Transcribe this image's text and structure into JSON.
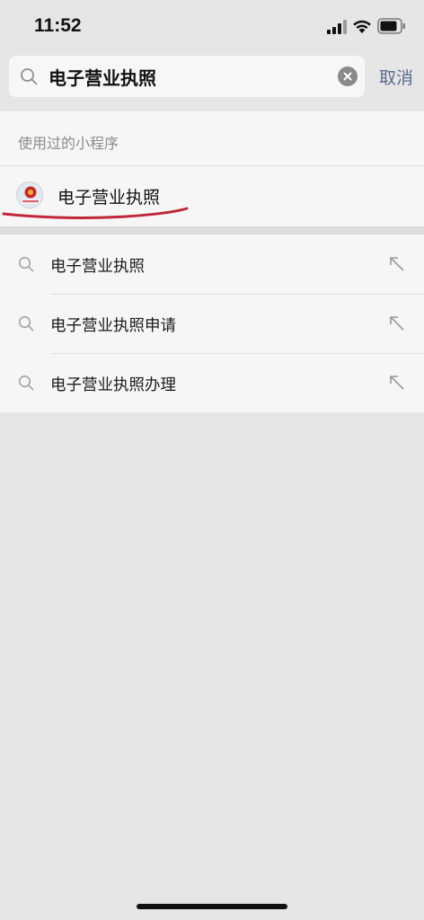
{
  "status_bar": {
    "time": "11:52"
  },
  "search": {
    "query": "电子营业执照",
    "cancel_label": "取消"
  },
  "mini_programs": {
    "section_title": "使用过的小程序",
    "items": [
      {
        "label": "电子营业执照",
        "avatar_text": "电子营业执照"
      }
    ]
  },
  "suggestions": [
    {
      "label": "电子营业执照"
    },
    {
      "label": "电子营业执照申请"
    },
    {
      "label": "电子营业执照办理"
    }
  ],
  "colors": {
    "background": "#e6e6e6",
    "card": "#f6f6f6",
    "cancel_text": "#5b6a8f",
    "underline_mark": "#c0283a"
  }
}
